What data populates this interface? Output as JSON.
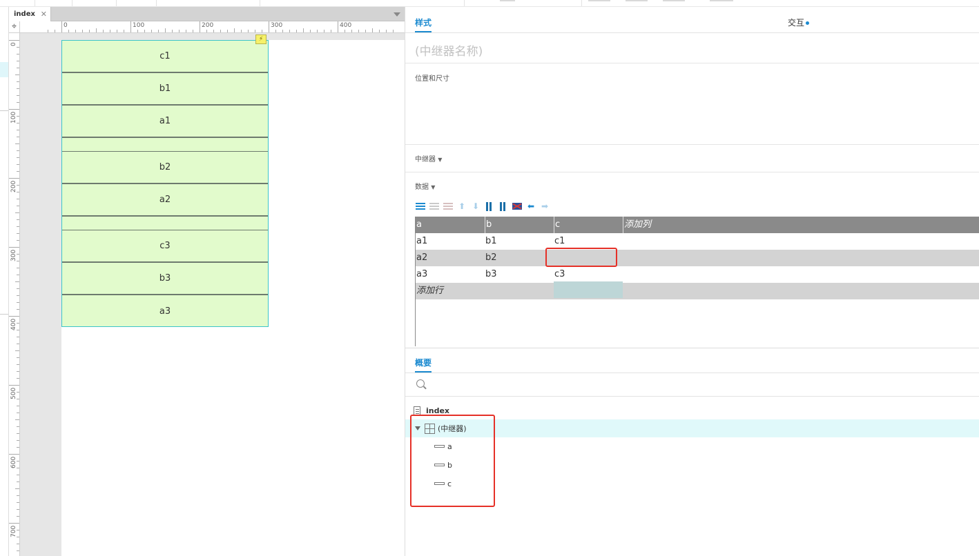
{
  "document_tab": {
    "label": "index"
  },
  "ruler": {
    "horizontal_labels": [
      "0",
      "100",
      "200",
      "300",
      "400"
    ],
    "vertical_labels": [
      "0",
      "100",
      "200",
      "300",
      "400",
      "500",
      "600",
      "700"
    ]
  },
  "canvas": {
    "repeater_items": [
      {
        "text": "c1"
      },
      {
        "text": "b1"
      },
      {
        "text": "a1"
      },
      {
        "text": "b2"
      },
      {
        "text": "a2"
      },
      {
        "text": "c3"
      },
      {
        "text": "b3"
      },
      {
        "text": "a3"
      }
    ],
    "bolt_icon": "lightning-icon"
  },
  "panel": {
    "tab_style": "样式",
    "tab_interaction": "交互",
    "name_placeholder": "(中继器名称)",
    "section_position": "位置和尺寸",
    "section_repeater": "中继器",
    "section_data": "数据"
  },
  "data_grid": {
    "columns": [
      "a",
      "b",
      "c"
    ],
    "add_column": "添加列",
    "rows": [
      [
        "a1",
        "b1",
        "c1"
      ],
      [
        "a2",
        "b2",
        ""
      ],
      [
        "a3",
        "b3",
        "c3"
      ]
    ],
    "add_row": "添加行"
  },
  "outline": {
    "tab_label": "概要",
    "search_placeholder": "",
    "page": "index",
    "repeater": "(中继器)",
    "children": [
      "a",
      "b",
      "c"
    ]
  },
  "colors": {
    "accent": "#1b8ad0",
    "highlight": "#e53027",
    "repeater_fill": "#e2fbcc",
    "repeater_border": "#3cc4c8"
  }
}
